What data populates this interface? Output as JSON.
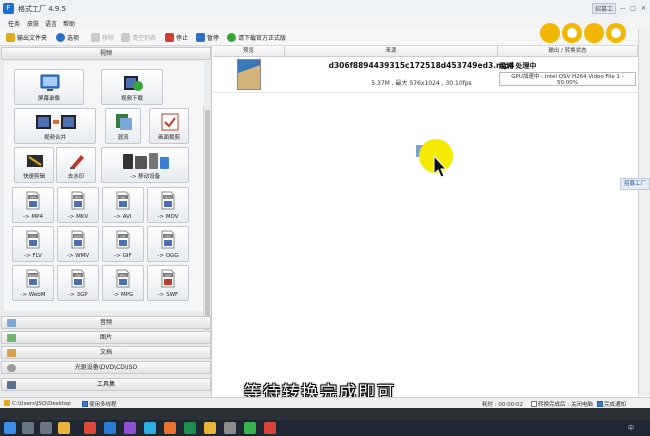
{
  "window": {
    "title": "格式工厂 4.9.5",
    "top_buttons": [
      "招募工厂",
      "—",
      "□",
      "✕"
    ]
  },
  "menu": [
    "任务",
    "皮肤",
    "语言",
    "帮助"
  ],
  "toolbar": {
    "items": [
      {
        "label": "输出文件夹",
        "enabled": true,
        "icon": "folder-icon",
        "color": "#e0a91f"
      },
      {
        "label": "选项",
        "enabled": true,
        "icon": "options-icon",
        "color": "#2f6fc9"
      },
      {
        "label": "移除",
        "enabled": false,
        "icon": "remove-icon",
        "color": "#b5b5b5"
      },
      {
        "label": "清空列表",
        "enabled": false,
        "icon": "clear-list-icon",
        "color": "#b5b5b5"
      },
      {
        "label": "停止",
        "enabled": true,
        "icon": "stop-icon",
        "color": "#d33c2f"
      },
      {
        "label": "暂停",
        "enabled": true,
        "icon": "pause-icon",
        "color": "#2f6fc9"
      },
      {
        "label": "请下载官方正式版",
        "enabled": true,
        "icon": "download-icon",
        "color": "#3aa53a"
      }
    ]
  },
  "left": {
    "video_header": "视频",
    "tiles": [
      {
        "label": "屏幕录像",
        "icon": "screen-record-icon",
        "size": "big"
      },
      {
        "label": "视频下载",
        "icon": "video-download-icon",
        "size": "big"
      },
      {
        "label": "视频合并",
        "icon": "video-merge-icon",
        "size": "big"
      },
      {
        "label": "混流",
        "icon": "mux-icon",
        "size": "big"
      },
      {
        "label": "画面裁剪",
        "icon": "crop-icon",
        "size": "big"
      },
      {
        "label": "快速剪辑",
        "icon": "quick-clip-icon",
        "size": "big"
      },
      {
        "label": "去水印",
        "icon": "remove-watermark-icon",
        "size": "big"
      },
      {
        "label": "-> 移动设备",
        "icon": "mobile-device-icon",
        "size": "wide"
      },
      {
        "label": "-> MP4",
        "icon": "mp4-file-icon",
        "badge": "MP4"
      },
      {
        "label": "-> MKV",
        "icon": "mkv-file-icon",
        "badge": "MKV"
      },
      {
        "label": "-> AVI",
        "icon": "avi-file-icon",
        "badge": "AVI"
      },
      {
        "label": "-> MOV",
        "icon": "mov-file-icon",
        "badge": "MOV"
      },
      {
        "label": "-> FLV",
        "icon": "flv-file-icon",
        "badge": "FLV"
      },
      {
        "label": "-> WMV",
        "icon": "wmv-file-icon",
        "badge": "WMV"
      },
      {
        "label": "-> GIF",
        "icon": "gif-file-icon",
        "badge": "GIF"
      },
      {
        "label": "-> OGG",
        "icon": "ogg-file-icon",
        "badge": "OGG"
      },
      {
        "label": "-> WebM",
        "icon": "webm-file-icon",
        "badge": "WebM"
      },
      {
        "label": "-> 3GP",
        "icon": "3gp-file-icon",
        "badge": "3GP"
      },
      {
        "label": "-> MPG",
        "icon": "mpg-file-icon",
        "badge": "MPG"
      },
      {
        "label": "-> SWF",
        "icon": "swf-file-icon",
        "badge": "SWF"
      }
    ],
    "categories": [
      {
        "label": "音频",
        "icon": "audio-icon",
        "color": "#7fa8d8"
      },
      {
        "label": "图片",
        "icon": "picture-icon",
        "color": "#6fb36f"
      },
      {
        "label": "文档",
        "icon": "document-icon",
        "color": "#d8a04a"
      },
      {
        "label": "光驱设备\\DVD\\CD\\ISO",
        "icon": "disc-icon",
        "color": "#9b9b9b"
      },
      {
        "label": "工具集",
        "icon": "toolbox-icon",
        "color": "#5b6f8c"
      }
    ]
  },
  "task_list": {
    "columns": [
      "预览",
      "来源",
      "输出 / 转换状态"
    ],
    "rows": [
      {
        "filename": "d306f8894439315c172518d453749ed3.mp4",
        "info": "5.37M , 最大 576x1024 , 30.10fps",
        "status_title": "混流 处理中",
        "status_detail": "GPU加速中 : Intel QSV H264 Video File 1 - 50.00%"
      }
    ]
  },
  "side_notice": "招募工厂",
  "caption": "等待转换完成即可",
  "statusbar": {
    "path": "C:\\Users\\JSQ\\Desktop",
    "multithread_label": "使用多线程",
    "multithread_checked": true,
    "elapsed_label": "耗时 : 00:00:02",
    "after_done_label": "转换完成后 : 关闭电脑",
    "after_done_checked": false,
    "notify_label": "完成通知",
    "notify_checked": true
  },
  "taskbar": {
    "apps": [
      {
        "icon": "start-icon",
        "color": "#3a8ee6"
      },
      {
        "icon": "search-icon",
        "color": "#6b7685"
      },
      {
        "icon": "task-view-icon",
        "color": "#6b7685"
      },
      {
        "icon": "file-explorer-icon",
        "color": "#e8b53a"
      },
      {
        "icon": "chrome-icon",
        "color": "#de4a39"
      },
      {
        "icon": "photoshop-icon",
        "color": "#2b7cd3"
      },
      {
        "icon": "premiere-icon",
        "color": "#8e4fd1"
      },
      {
        "icon": "browser-icon",
        "color": "#2fb0e5"
      },
      {
        "icon": "media-player-icon",
        "color": "#e8742f"
      },
      {
        "icon": "excel-icon",
        "color": "#1f8f4f"
      },
      {
        "icon": "folder-icon",
        "color": "#e8b53a"
      },
      {
        "icon": "camera-icon",
        "color": "#8c8c8c"
      },
      {
        "icon": "chat-icon",
        "color": "#37b24d"
      },
      {
        "icon": "format-factory-icon",
        "color": "#d8443a"
      }
    ],
    "tray_text": "中"
  },
  "colors": {
    "accent": "#1a6fd0",
    "cursor_highlight": "#f2ea00"
  }
}
